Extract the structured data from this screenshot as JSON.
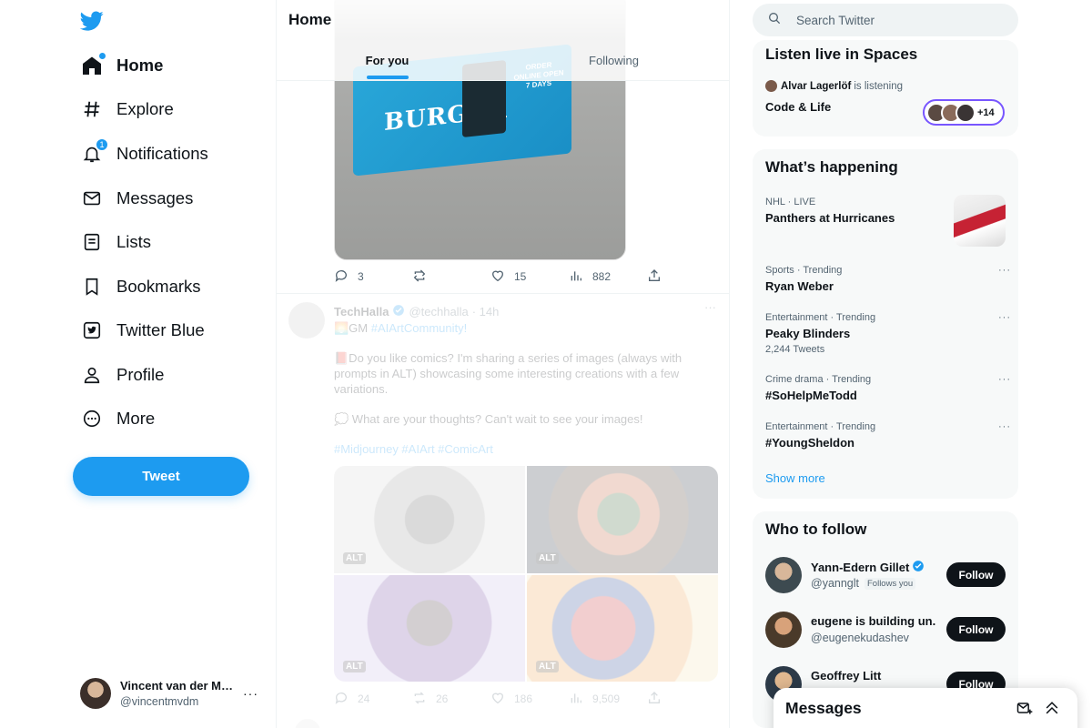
{
  "nav": {
    "items": [
      {
        "label": "Home",
        "icon": "home-icon"
      },
      {
        "label": "Explore",
        "icon": "hashtag-icon"
      },
      {
        "label": "Notifications",
        "icon": "bell-icon",
        "badge": "1"
      },
      {
        "label": "Messages",
        "icon": "envelope-icon"
      },
      {
        "label": "Lists",
        "icon": "list-icon"
      },
      {
        "label": "Bookmarks",
        "icon": "bookmark-icon"
      },
      {
        "label": "Twitter Blue",
        "icon": "twitter-blue-icon"
      },
      {
        "label": "Profile",
        "icon": "person-icon"
      },
      {
        "label": "More",
        "icon": "more-circle-icon"
      }
    ],
    "tweet_label": "Tweet"
  },
  "account": {
    "name": "Vincent van der Me...",
    "handle": "@vincentmvdm",
    "more": "···"
  },
  "main": {
    "title": "Home",
    "tabs": [
      {
        "label": "For you"
      },
      {
        "label": "Following"
      }
    ]
  },
  "tweet1": {
    "photo": {
      "burger": "BURGER",
      "promo": "ORDER ONLINE OPEN 7 DAYS"
    },
    "actions": {
      "replies": "3",
      "retweets": "",
      "likes": "15",
      "views": "882"
    }
  },
  "tweet2": {
    "name": "TechHalla",
    "handle": "@techhalla",
    "time": "· 14h",
    "more": "···",
    "line1": "🌅GM ",
    "line1_link": "#AIArtCommunity!",
    "line2": "📕Do you like comics? I'm sharing a series of images (always with prompts in ALT) showcasing some interesting creations with a few variations.",
    "line3": "💭 What are your thoughts? Can't wait to see your images!",
    "tags": "#Midjourney #AIArt #ComicArt",
    "alt": "ALT",
    "actions": {
      "replies": "24",
      "retweets": "26",
      "likes": "186",
      "views": "9,509"
    }
  },
  "search": {
    "placeholder": "Search Twitter"
  },
  "spaces": {
    "title": "Listen live in Spaces",
    "listener": "Alvar Lagerlöf",
    "listening": "is listening",
    "space_name": "Code & Life",
    "count": "+14",
    "accent": "#7856ff"
  },
  "happening": {
    "title": "What’s happening",
    "trends": [
      {
        "meta": "NHL · LIVE",
        "name": "Panthers at Hurricanes",
        "count": ""
      },
      {
        "meta": "Sports · Trending",
        "name": "Ryan Weber",
        "count": ""
      },
      {
        "meta": "Entertainment · Trending",
        "name": "Peaky Blinders",
        "count": "2,244 Tweets"
      },
      {
        "meta": "Crime drama · Trending",
        "name": "#SoHelpMeTodd",
        "count": ""
      },
      {
        "meta": "Entertainment · Trending",
        "name": "#YoungSheldon",
        "count": ""
      }
    ],
    "show_more": "Show more"
  },
  "who_to_follow": {
    "title": "Who to follow",
    "users": [
      {
        "name": "Yann-Edern Gillet",
        "handle": "@yannglt",
        "note": "Follows you",
        "verified": true,
        "button": "Follow"
      },
      {
        "name": "eugene is building un...",
        "handle": "@eugenekudashev",
        "note": "",
        "verified": false,
        "button": "Follow"
      },
      {
        "name": "Geoffrey Litt",
        "handle": "",
        "note": "",
        "verified": false,
        "button": "Follow"
      }
    ]
  },
  "messages_drawer": {
    "title": "Messages"
  },
  "colors": {
    "accent": "#1d9bf0",
    "text": "#0f1419",
    "muted": "#536471"
  }
}
